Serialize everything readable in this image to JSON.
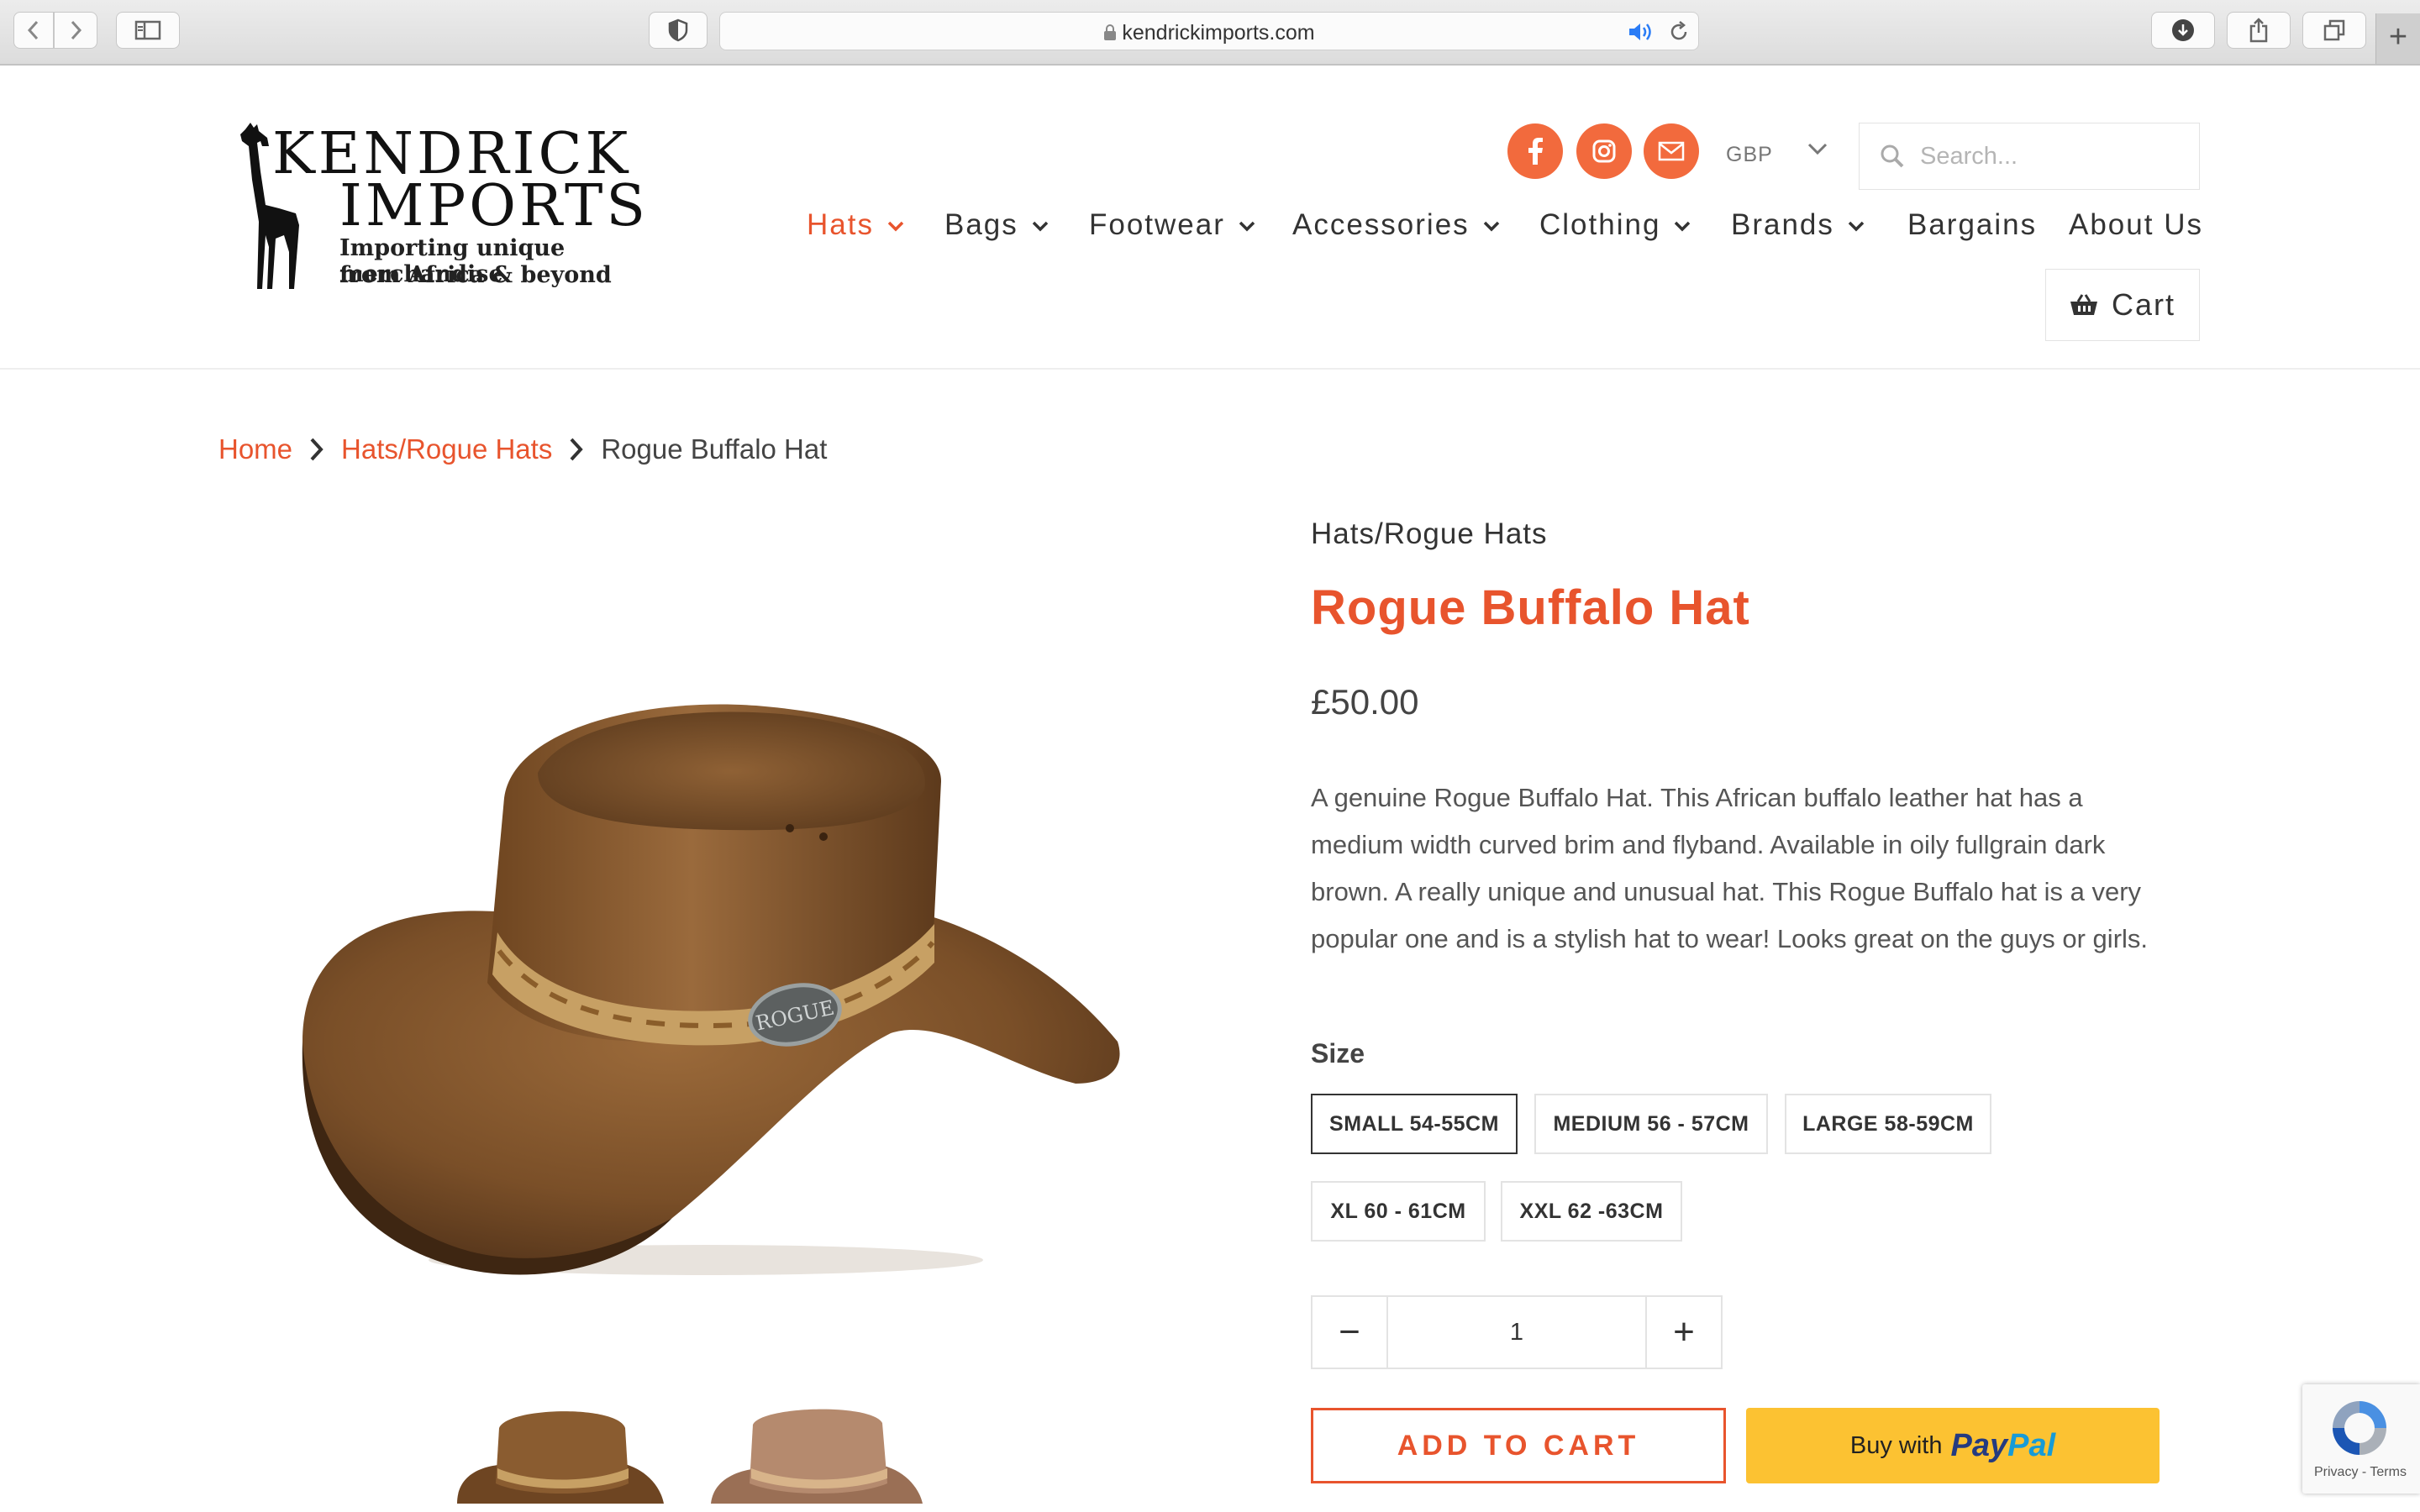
{
  "browser": {
    "url": "kendrickimports.com"
  },
  "logo": {
    "line1": "KENDRICK",
    "line2": "IMPORTS",
    "tagline1": "Importing unique merchandise",
    "tagline2": "from Africa & beyond"
  },
  "header": {
    "social": [
      {
        "icon": "facebook-icon"
      },
      {
        "icon": "instagram-icon"
      },
      {
        "icon": "mail-icon"
      }
    ],
    "currency": "GBP",
    "search_placeholder": "Search...",
    "cart_label": "Cart",
    "nav": [
      {
        "label": "Hats",
        "dropdown": true,
        "active": true
      },
      {
        "label": "Bags",
        "dropdown": true
      },
      {
        "label": "Footwear",
        "dropdown": true
      },
      {
        "label": "Accessories",
        "dropdown": true
      },
      {
        "label": "Clothing",
        "dropdown": true
      },
      {
        "label": "Brands",
        "dropdown": true
      },
      {
        "label": "Bargains",
        "dropdown": false
      },
      {
        "label": "About Us",
        "dropdown": false
      }
    ]
  },
  "breadcrumb": {
    "home": "Home",
    "category": "Hats/Rogue Hats",
    "current": "Rogue Buffalo Hat"
  },
  "product": {
    "vendor": "Hats/Rogue Hats",
    "title": "Rogue Buffalo Hat",
    "price": "£50.00",
    "description": "A genuine Rogue Buffalo Hat. This African buffalo leather hat has a medium width curved brim and flyband. Available in oily fullgrain dark brown. A really unique and unusual hat. This Rogue Buffalo hat is a very popular one and is a stylish hat to wear! Looks great on the guys or girls.",
    "hat_badge": "ROGUE",
    "size_label": "Size",
    "sizes": [
      {
        "label": "SMALL 54-55CM",
        "selected": true
      },
      {
        "label": "MEDIUM 56 - 57CM",
        "selected": false
      },
      {
        "label": "LARGE 58-59CM",
        "selected": false
      },
      {
        "label": "XL 60 - 61CM",
        "selected": false
      },
      {
        "label": "XXL 62 -63CM",
        "selected": false
      }
    ],
    "quantity": "1",
    "qty_minus": "−",
    "qty_plus": "+",
    "add_to_cart": "ADD TO CART",
    "paypal_buy": "Buy with",
    "paypal_pay": "Pay",
    "paypal_pal": "Pal"
  },
  "recaptcha": {
    "text": "Privacy - Terms"
  },
  "colors": {
    "accent": "#e8542d",
    "social": "#f26a3d",
    "paypal_bg": "#fcc232"
  }
}
